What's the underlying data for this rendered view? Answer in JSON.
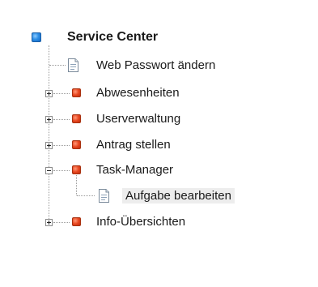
{
  "tree": {
    "root": {
      "label": "Service Center",
      "icon": "blue-bullet-icon",
      "color": "#2d8fe6"
    },
    "items": [
      {
        "label": "Web Passwort ändern",
        "type": "page",
        "expander": "none",
        "icon": "document-icon"
      },
      {
        "label": "Abwesenheiten",
        "type": "folder",
        "expander": "plus",
        "icon": "red-bullet-icon"
      },
      {
        "label": "Userverwaltung",
        "type": "folder",
        "expander": "plus",
        "icon": "red-bullet-icon"
      },
      {
        "label": "Antrag stellen",
        "type": "folder",
        "expander": "plus",
        "icon": "red-bullet-icon"
      },
      {
        "label": "Task-Manager",
        "type": "folder",
        "expander": "minus",
        "icon": "red-bullet-icon",
        "children": [
          {
            "label": "Aufgabe bearbeiten",
            "type": "page",
            "selected": true,
            "icon": "document-icon"
          }
        ]
      },
      {
        "label": "Info-Übersichten",
        "type": "folder",
        "expander": "plus",
        "icon": "red-bullet-icon"
      }
    ],
    "colors": {
      "folder_bullet": "#e8461f",
      "selected_background": "#ededed",
      "connector": "#9a9a9a"
    }
  }
}
